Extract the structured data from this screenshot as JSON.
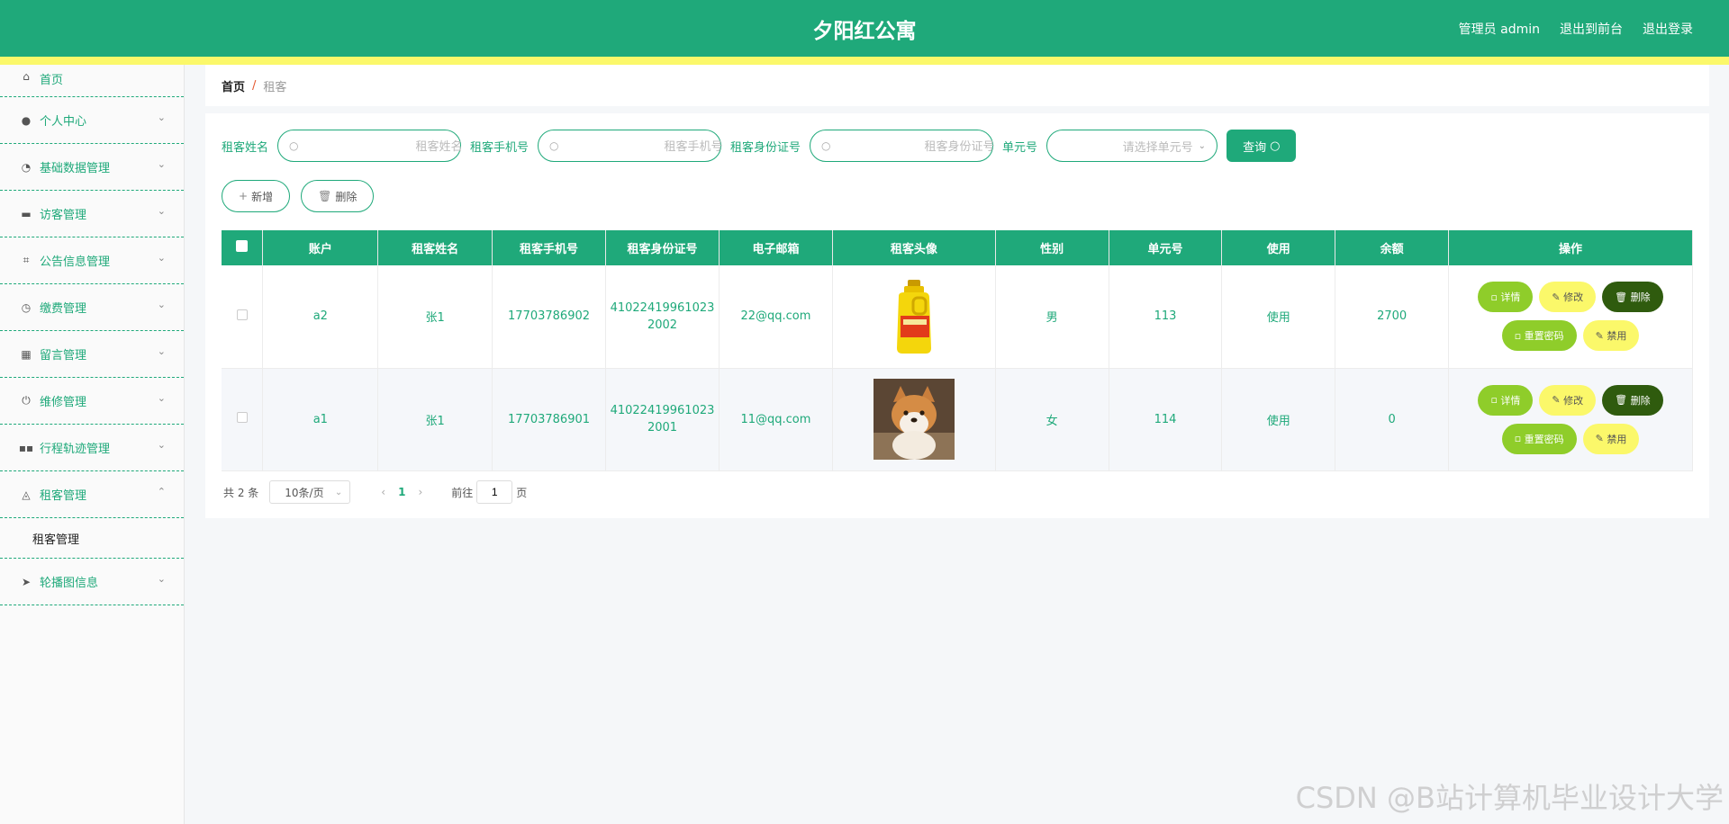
{
  "header": {
    "title": "夕阳红公寓",
    "admin_label": "管理员 admin",
    "front_label": "退出到前台",
    "logout_label": "退出登录"
  },
  "sidebar": {
    "items": [
      {
        "label": "首页",
        "icon": "home-icon"
      },
      {
        "label": "个人中心",
        "icon": "user-icon"
      },
      {
        "label": "基础数据管理",
        "icon": "gauge-icon"
      },
      {
        "label": "访客管理",
        "icon": "briefcase-icon"
      },
      {
        "label": "公告信息管理",
        "icon": "crop-icon"
      },
      {
        "label": "缴费管理",
        "icon": "clock-icon"
      },
      {
        "label": "留言管理",
        "icon": "chart-icon"
      },
      {
        "label": "维修管理",
        "icon": "power-icon"
      },
      {
        "label": "行程轨迹管理",
        "icon": "grid-icon"
      },
      {
        "label": "租客管理",
        "icon": "bell-off-icon"
      },
      {
        "label": "轮播图信息",
        "icon": "send-icon"
      }
    ],
    "submenu_label": "租客管理"
  },
  "breadcrumb": {
    "home": "首页",
    "separator": "/",
    "current": "租客"
  },
  "search": {
    "name_label": "租客姓名",
    "name_placeholder": "租客姓名",
    "phone_label": "租客手机号",
    "phone_placeholder": "租客手机号",
    "id_label": "租客身份证号",
    "id_placeholder": "租客身份证号",
    "unit_label": "单元号",
    "unit_placeholder": "请选择单元号",
    "query_label": "查询"
  },
  "actions": {
    "add_label": "新增",
    "delete_label": "删除"
  },
  "table": {
    "columns": [
      "账户",
      "租客姓名",
      "租客手机号",
      "租客身份证号",
      "电子邮箱",
      "租客头像",
      "性别",
      "单元号",
      "使用",
      "余额",
      "操作"
    ],
    "rows": [
      {
        "account": "a2",
        "name": "张1",
        "phone": "17703786902",
        "id_line1": "41022419961023",
        "id_line2": "2002",
        "email": "22@qq.com",
        "gender": "男",
        "unit": "113",
        "status": "使用",
        "balance": "2700"
      },
      {
        "account": "a1",
        "name": "张1",
        "phone": "17703786901",
        "id_line1": "41022419961023",
        "id_line2": "2001",
        "email": "11@qq.com",
        "gender": "女",
        "unit": "114",
        "status": "使用",
        "balance": "0"
      }
    ],
    "op_labels": {
      "detail": "详情",
      "edit": "修改",
      "delete": "删除",
      "reset": "重置密码",
      "ban": "禁用"
    }
  },
  "pagination": {
    "total": "共 2 条",
    "page_size": "10条/页",
    "current_page": "1",
    "goto_label": "前往",
    "goto_value": "1",
    "page_suffix": "页"
  },
  "watermark": "CSDN @B站计算机毕业设计大学",
  "colors": {
    "primary": "#1fa97a",
    "stripe": "#fbf86a",
    "detail_btn": "#8fcd2a",
    "edit_btn": "#fbf86a",
    "delete_btn": "#2f5b0e"
  }
}
